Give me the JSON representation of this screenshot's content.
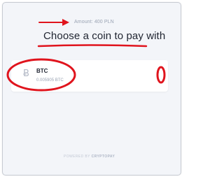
{
  "payment": {
    "amount_text": "Amount: 400 PLN",
    "title": "Choose a coin to pay with"
  },
  "coins": [
    {
      "code": "BTC",
      "price": "0.005905 BTC",
      "icon": "bitcoin-icon",
      "icon_glyph": "Ƀ",
      "chevron_glyph": "›"
    }
  ],
  "footer": {
    "powered_by": "POWERED BY",
    "brand": "CRYPTOPAY"
  },
  "colors": {
    "annotation": "#e0141d",
    "background": "#f3f5f9",
    "card": "#ffffff",
    "text_primary": "#1f2430",
    "text_muted": "#9aa3b3"
  }
}
